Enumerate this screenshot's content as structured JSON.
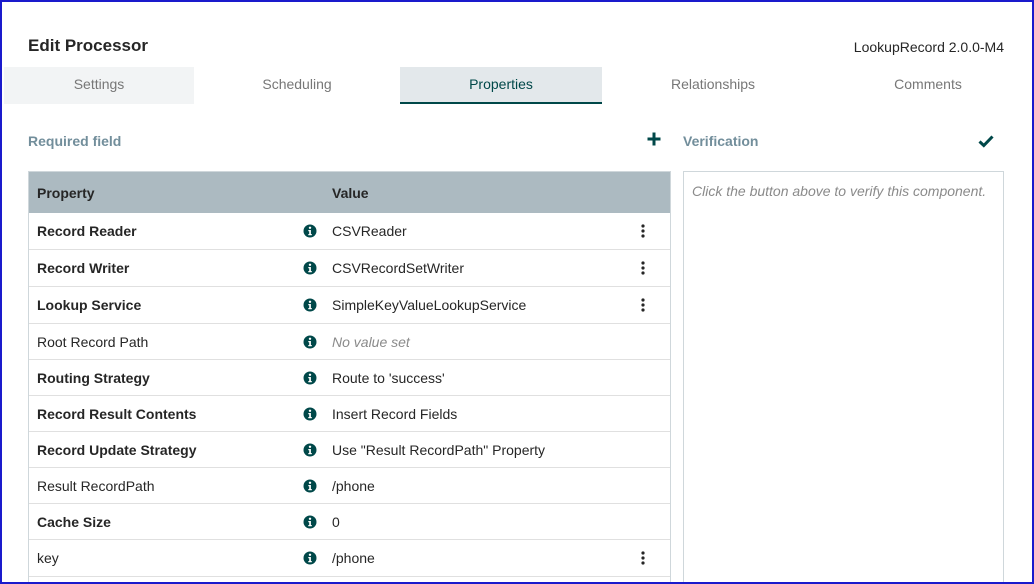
{
  "dialog": {
    "title": "Edit Processor",
    "version": "LookupRecord 2.0.0-M4"
  },
  "tabs": [
    {
      "label": "Settings"
    },
    {
      "label": "Scheduling"
    },
    {
      "label": "Properties"
    },
    {
      "label": "Relationships"
    },
    {
      "label": "Comments"
    }
  ],
  "active_tab": "Properties",
  "properties_panel": {
    "required_label": "Required field",
    "add_icon": "plus-icon",
    "headers": {
      "property": "Property",
      "value": "Value"
    },
    "rows": [
      {
        "name": "Record Reader",
        "value": "CSVReader",
        "required": true,
        "unset": false,
        "menu": true
      },
      {
        "name": "Record Writer",
        "value": "CSVRecordSetWriter",
        "required": true,
        "unset": false,
        "menu": true
      },
      {
        "name": "Lookup Service",
        "value": "SimpleKeyValueLookupService",
        "required": true,
        "unset": false,
        "menu": true
      },
      {
        "name": "Root Record Path",
        "value": "No value set",
        "required": false,
        "unset": true,
        "menu": false
      },
      {
        "name": "Routing Strategy",
        "value": "Route to 'success'",
        "required": true,
        "unset": false,
        "menu": false
      },
      {
        "name": "Record Result Contents",
        "value": "Insert Record Fields",
        "required": true,
        "unset": false,
        "menu": false
      },
      {
        "name": "Record Update Strategy",
        "value": "Use \"Result RecordPath\" Property",
        "required": true,
        "unset": false,
        "menu": false
      },
      {
        "name": "Result RecordPath",
        "value": "/phone",
        "required": false,
        "unset": false,
        "menu": false
      },
      {
        "name": "Cache Size",
        "value": "0",
        "required": true,
        "unset": false,
        "menu": false
      },
      {
        "name": "key",
        "value": "/phone",
        "required": false,
        "unset": false,
        "menu": true
      }
    ]
  },
  "verification": {
    "label": "Verification",
    "check_icon": "checkmark-icon",
    "placeholder": "Click the button above to verify this component."
  },
  "colors": {
    "accent": "#004849",
    "header_bg": "#acbac1",
    "label_gray": "#728e9b",
    "window_border": "#1a1acc"
  }
}
